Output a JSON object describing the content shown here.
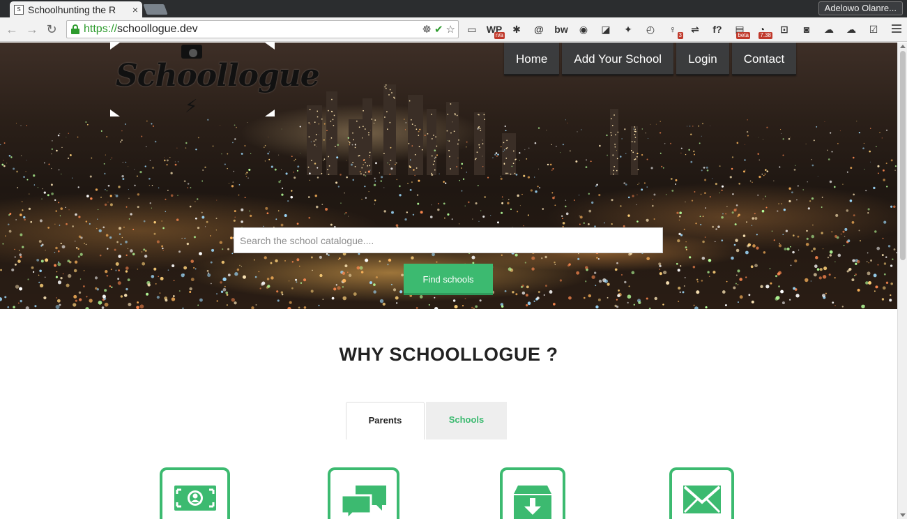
{
  "browser": {
    "tab_title": "Schoolhunting the R",
    "tab_close": "×",
    "profile_name": "Adelowo Olanre...",
    "url_scheme": "https://",
    "url_host": "schoollogue.dev",
    "nav": {
      "back": "←",
      "forward": "→",
      "reload": "↻"
    },
    "omni_icons": [
      "☸",
      "✔",
      "☆"
    ],
    "extensions": [
      {
        "name": "cast-icon",
        "glyph": "▭"
      },
      {
        "name": "wp-icon",
        "glyph": "WP",
        "badge": "n/a"
      },
      {
        "name": "gear-icon",
        "glyph": "✱"
      },
      {
        "name": "at-icon",
        "glyph": "@"
      },
      {
        "name": "bw-icon",
        "glyph": "bw"
      },
      {
        "name": "film-icon",
        "glyph": "◉"
      },
      {
        "name": "mirror-icon",
        "glyph": "◪"
      },
      {
        "name": "twitter-icon",
        "glyph": "✦"
      },
      {
        "name": "clock-icon",
        "glyph": "◴"
      },
      {
        "name": "bulb-icon",
        "glyph": "♀",
        "badge": "3"
      },
      {
        "name": "sync-icon",
        "glyph": "⇌"
      },
      {
        "name": "function-icon",
        "glyph": "f?"
      },
      {
        "name": "monitor-icon",
        "glyph": "▤",
        "badge": "beta"
      },
      {
        "name": "speed-icon",
        "glyph": "◔",
        "badge": "7.38"
      },
      {
        "name": "pocket-icon",
        "glyph": "⊡"
      },
      {
        "name": "camera-icon",
        "glyph": "◙"
      },
      {
        "name": "cloud-icon",
        "glyph": "☁"
      },
      {
        "name": "cloud-outline-icon",
        "glyph": "☁"
      },
      {
        "name": "check-icon",
        "glyph": "☑"
      }
    ]
  },
  "site": {
    "logo_text": "Schoollogue",
    "nav": [
      {
        "id": "home",
        "label": "Home"
      },
      {
        "id": "add-school",
        "label": "Add Your School"
      },
      {
        "id": "login",
        "label": "Login"
      },
      {
        "id": "contact",
        "label": "Contact"
      }
    ],
    "search": {
      "placeholder": "Search the school catalogue....",
      "button": "Find schools"
    },
    "why_title": "WHY SCHOOLLOGUE ?",
    "tabs": [
      {
        "id": "parents",
        "label": "Parents",
        "active": true
      },
      {
        "id": "schools",
        "label": "Schools",
        "active": false
      }
    ],
    "features": [
      {
        "icon": "money-icon"
      },
      {
        "icon": "chat-icon"
      },
      {
        "icon": "archive-download-icon"
      },
      {
        "icon": "envelope-icon"
      }
    ],
    "colors": {
      "accent_green": "#3cba70",
      "nav_bg": "#3c3e40",
      "title_text": "#222222"
    }
  }
}
